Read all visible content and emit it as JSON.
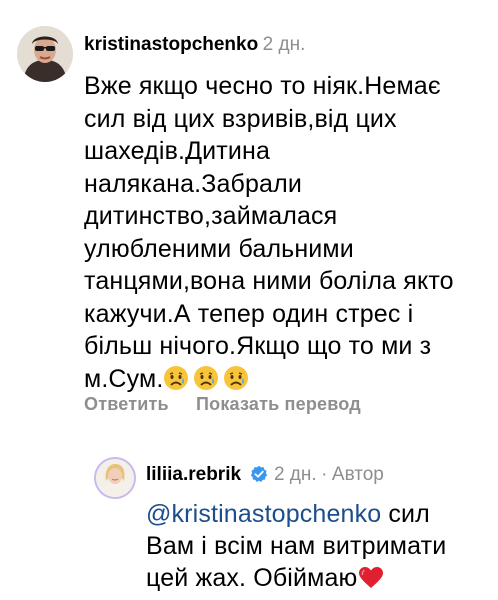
{
  "comment": {
    "username": "kristinastopchenko",
    "time": "2 дн.",
    "lines": [
      "Вже якщо чесно то ніяк.Немає",
      "сил від цих взривів,від цих",
      "шахедів.Дитина",
      "налякана.Забрали",
      "дитинство,займалася",
      "улюбленими бальними",
      "танцями,вона ними боліла якто",
      "кажучи.А тепер один стрес і",
      "більш нічого.Якщо що то ми з",
      "м.Сум."
    ],
    "emojis": [
      "sad-face-emoji",
      "sad-face-emoji",
      "sad-face-emoji"
    ],
    "reply_label": "Ответить",
    "translate_label": "Показать перевод"
  },
  "reply": {
    "username": "liliia.rebrik",
    "time": "2 дн.",
    "separator": "·",
    "author_label": "Автор",
    "mention": "@kristinastopchenko",
    "line1_rest": "сил",
    "line2": "Вам і всім нам витримати",
    "line3": "цей жах. Обіймаю",
    "heart": "red-heart-emoji"
  },
  "colors": {
    "secondary": "#8e8e8e",
    "mention": "#1c4d8c",
    "verified": "#3897f0",
    "heart": "#e0202e"
  }
}
